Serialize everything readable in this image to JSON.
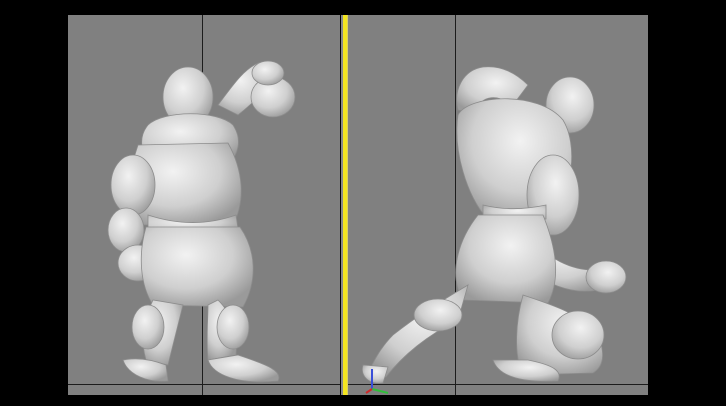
{
  "window": {
    "title": ""
  },
  "viewports": {
    "left": {
      "name": "front-view",
      "background": "#808080"
    },
    "right": {
      "name": "side-view",
      "background": "#808080"
    }
  },
  "scene": {
    "subject": "boxer-character-model",
    "model_color": "#d8d8d8"
  },
  "colors": {
    "divider": "#f4e51f",
    "grid": "#1c1c1c",
    "axis_x": "#d02a2a",
    "axis_y": "#2fbf3a",
    "axis_z": "#3a4fd8"
  }
}
